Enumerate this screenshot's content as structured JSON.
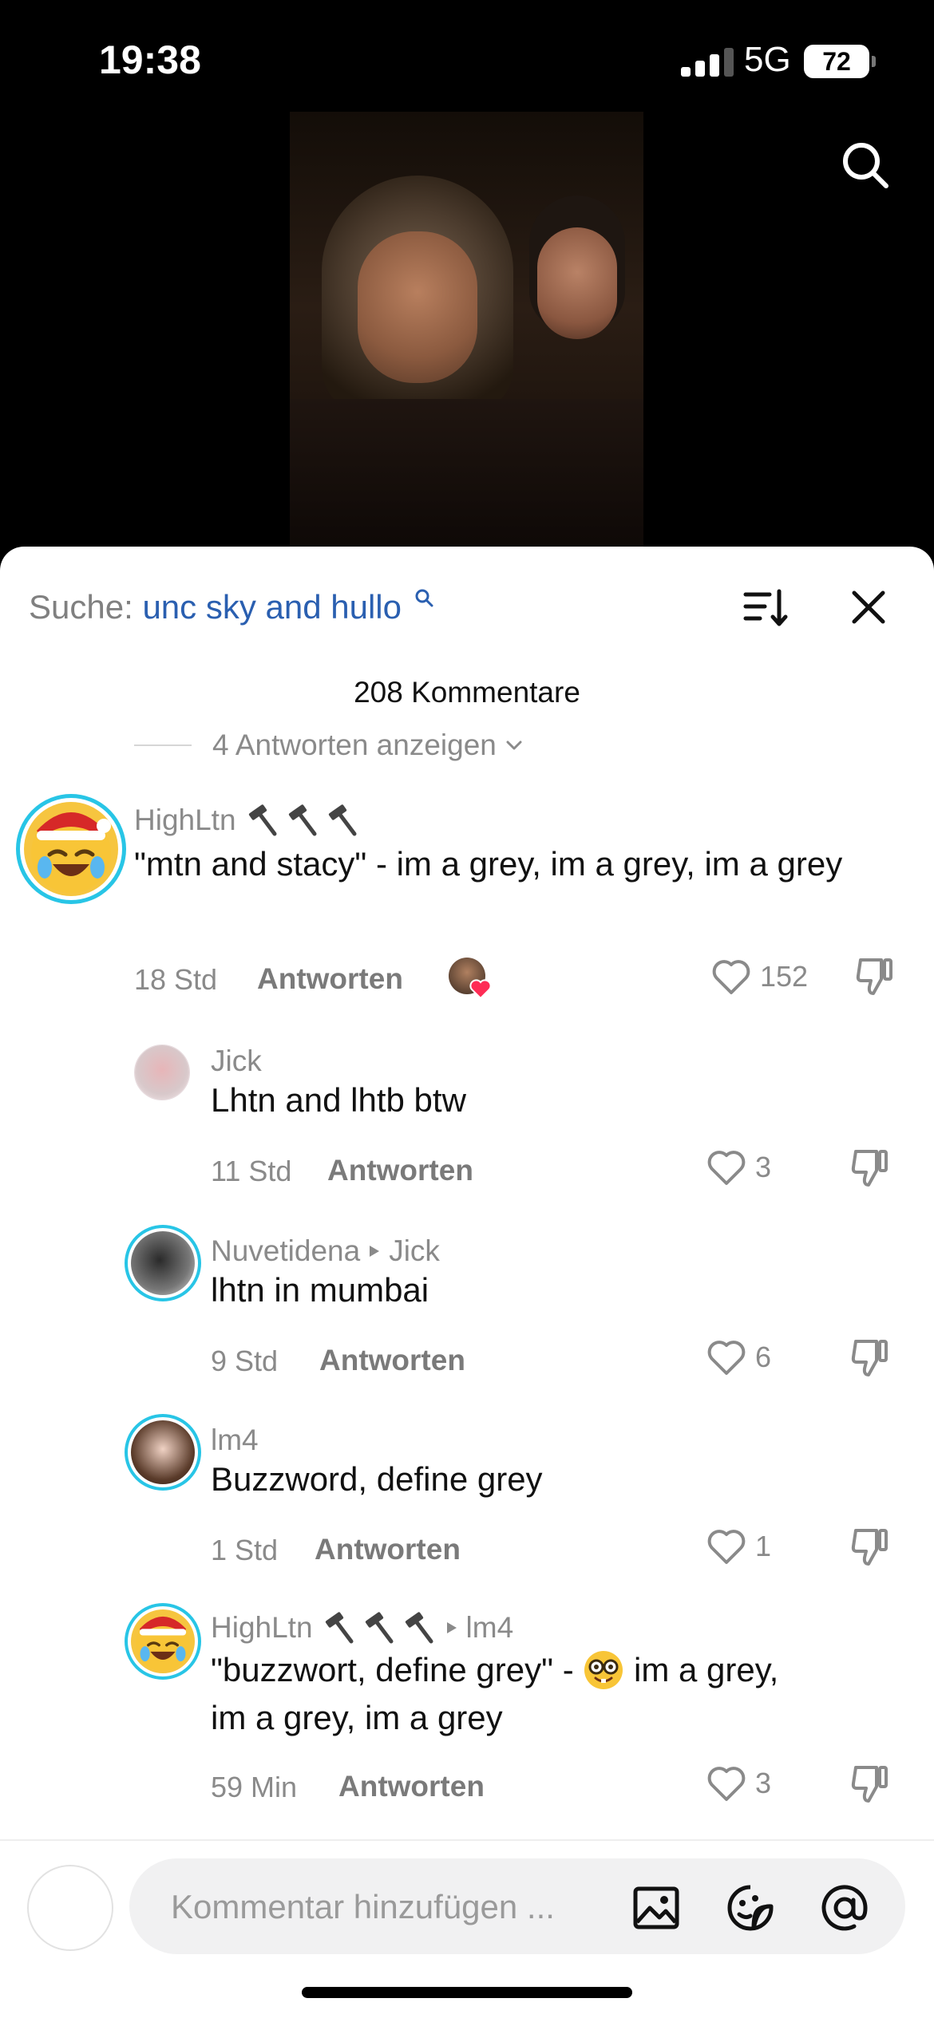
{
  "status_bar": {
    "time": "19:38",
    "network": "5G",
    "battery": "72"
  },
  "video": {
    "search_icon": "search-icon"
  },
  "comments_panel": {
    "search_label": "Suche:",
    "search_query": "unc sky and hullo",
    "comment_count": "208 Kommentare",
    "show_replies": "4 Antworten anzeigen",
    "reply_label": "Antworten",
    "comments": [
      {
        "user": "HighLtn",
        "text": "\"mtn and stacy\" - im a grey, im a grey, im a grey",
        "time": "18 Std",
        "likes": "152",
        "creator_liked": true
      },
      {
        "user": "Jick",
        "text": "Lhtn and lhtb btw",
        "time": "11 Std",
        "likes": "3"
      },
      {
        "user": "Nuvetidena",
        "reply_to": "Jick",
        "text": "lhtn in mumbai",
        "time": "9 Std",
        "likes": "6"
      },
      {
        "user": "lm4",
        "text": "Buzzword, define grey",
        "time": "1 Std",
        "likes": "1"
      },
      {
        "user": "HighLtn",
        "reply_to": "lm4",
        "text_before": "\"buzzwort, define grey\" -",
        "emoji": "nerd-face",
        "text_after": "im a grey,",
        "text_line2": "im a grey, im a grey",
        "time": "59 Min",
        "likes": "3"
      }
    ]
  },
  "input": {
    "placeholder": "Kommentar hinzufügen ..."
  },
  "colors": {
    "link_blue": "#2a5fb0",
    "ring_cyan": "#28c5e6",
    "muted_grey": "#8a8a8a"
  }
}
